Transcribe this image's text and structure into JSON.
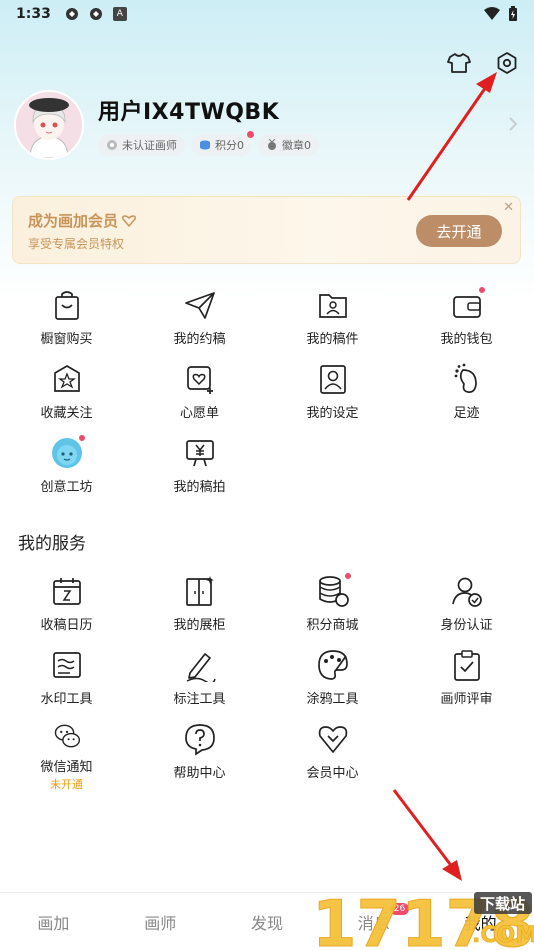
{
  "status": {
    "time": "1:33",
    "a_label": "A"
  },
  "user": {
    "name": "用户IX4TWQBK",
    "badges": [
      {
        "label": "未认证画师",
        "icon": "cert-icon"
      },
      {
        "label": "积分0",
        "icon": "coin-icon"
      },
      {
        "label": "徽章0",
        "icon": "medal-icon"
      }
    ]
  },
  "vip": {
    "title": "成为画加会员",
    "subtitle": "享受专属会员特权",
    "button": "去开通"
  },
  "shortcuts": [
    {
      "label": "橱窗购买",
      "icon": "shopping-bag-icon"
    },
    {
      "label": "我的约稿",
      "icon": "paper-plane-icon"
    },
    {
      "label": "我的稿件",
      "icon": "folder-user-icon"
    },
    {
      "label": "我的钱包",
      "icon": "wallet-icon",
      "dot": true
    },
    {
      "label": "收藏关注",
      "icon": "star-box-icon"
    },
    {
      "label": "心愿单",
      "icon": "wish-heart-icon"
    },
    {
      "label": "我的设定",
      "icon": "profile-card-icon"
    },
    {
      "label": "足迹",
      "icon": "footprint-icon"
    },
    {
      "label": "创意工坊",
      "icon": "creative-workshop-icon",
      "dot": true
    },
    {
      "label": "我的稿拍",
      "icon": "yen-board-icon"
    }
  ],
  "services_title": "我的服务",
  "services": [
    {
      "label": "收稿日历",
      "icon": "calendar-icon"
    },
    {
      "label": "我的展柜",
      "icon": "showcase-icon"
    },
    {
      "label": "积分商城",
      "icon": "coins-stack-icon",
      "dot": true
    },
    {
      "label": "身份认证",
      "icon": "identity-check-icon"
    },
    {
      "label": "水印工具",
      "icon": "watermark-icon"
    },
    {
      "label": "标注工具",
      "icon": "pen-icon"
    },
    {
      "label": "涂鸦工具",
      "icon": "palette-icon"
    },
    {
      "label": "画师评审",
      "icon": "clipboard-check-icon"
    },
    {
      "label": "微信通知",
      "icon": "wechat-icon",
      "sub": "未开通"
    },
    {
      "label": "帮助中心",
      "icon": "help-icon"
    },
    {
      "label": "会员中心",
      "icon": "vip-heart-icon"
    }
  ],
  "nav": [
    {
      "label": "画加"
    },
    {
      "label": "画师"
    },
    {
      "label": "发现"
    },
    {
      "label": "消息",
      "badge": "26"
    },
    {
      "label": "我的",
      "active": true
    }
  ],
  "watermark": {
    "text": "17178",
    "sub": "下载站",
    "domain": ".COM"
  },
  "colors": {
    "accent": "#ef4c6c",
    "vip_gold": "#c9945a",
    "vip_button": "#bc8d67",
    "annotation": "#e02020"
  }
}
